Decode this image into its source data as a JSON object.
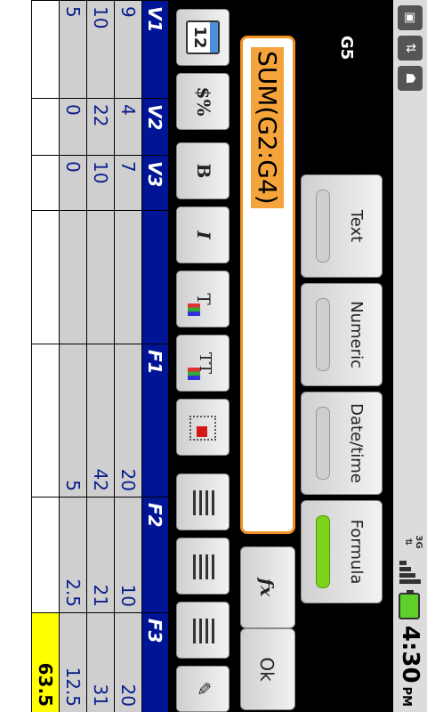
{
  "status_bar": {
    "time": "4:30",
    "ampm": "PM",
    "network": "3G",
    "icons": [
      "sd-card-icon",
      "usb-icon",
      "android-debug-icon"
    ]
  },
  "editor": {
    "cell_ref": "G5",
    "formula": "SUM(G2:G4)",
    "type_buttons": [
      {
        "label": "Text",
        "active": false
      },
      {
        "label": "Numeric",
        "active": false
      },
      {
        "label": "Date/time",
        "active": false
      },
      {
        "label": "Formula",
        "active": true
      }
    ],
    "fx_label": "fx",
    "ok_label": "Ok"
  },
  "toolbar": {
    "calendar_glyph": "12",
    "currency_glyph": "$%",
    "bold_glyph": "B",
    "italic_glyph": "I",
    "text_color_glyph": "T",
    "text_bg_glyph": "TT"
  },
  "sheet": {
    "headers": [
      "V1",
      "V2",
      "V3",
      "",
      "F1",
      "F2",
      "F3"
    ],
    "rows": [
      [
        "9",
        "4",
        "7",
        "",
        "20",
        "10",
        "20"
      ],
      [
        "10",
        "22",
        "10",
        "",
        "42",
        "21",
        "31"
      ],
      [
        "5",
        "0",
        "0",
        "",
        "5",
        "2.5",
        "12.5"
      ],
      [
        "",
        "",
        "",
        "",
        "",
        "",
        "63.5"
      ]
    ]
  }
}
